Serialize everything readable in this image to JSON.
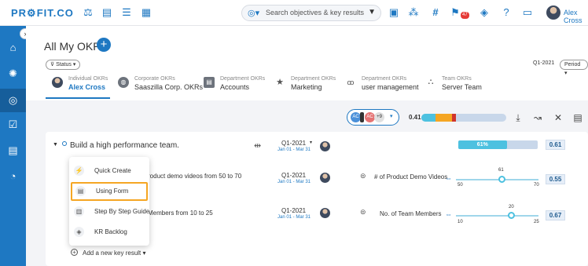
{
  "app": {
    "logo": "PR⚙FIT.CO"
  },
  "search": {
    "placeholder": "Search objectives & key results"
  },
  "topbar": {
    "notification_count": "47",
    "user_name": "Alex Cross"
  },
  "page": {
    "title": "All My OKRs",
    "status_filter": "Status",
    "quarter": "Q1-2021",
    "period": "Period"
  },
  "tabs": [
    {
      "label": "Individual OKRs",
      "value": "Alex Cross"
    },
    {
      "label": "Corporate OKRs",
      "value": "Saaszilla Corp. OKRs"
    },
    {
      "label": "Department OKRs",
      "value": "Accounts"
    },
    {
      "label": "Department OKRs",
      "value": "Marketing"
    },
    {
      "label": "Department OKRs",
      "value": "user management"
    },
    {
      "label": "Team OKRs",
      "value": "Server Team"
    }
  ],
  "summary": {
    "avatars": [
      "AC",
      "AC"
    ],
    "extra_count": "+9",
    "score": "0.41",
    "segments": [
      {
        "color": "#4dc1e0",
        "fraction": 0.17
      },
      {
        "color": "#f5a623",
        "fraction": 0.19
      },
      {
        "color": "#d0342c",
        "fraction": 0.05
      }
    ]
  },
  "objective": {
    "title": "Build a high performance team.",
    "date": "Q1-2021",
    "date_range": "Jan 01 - Mar 31",
    "progress_label": "61%",
    "progress": 0.61,
    "score": "0.61"
  },
  "key_results": [
    {
      "text": "roduct demo videos from 50 to 70",
      "date": "Q1-2021",
      "date_range": "Jan 01 - Mar 31",
      "metric": "# of Product Demo Videos",
      "current": "61",
      "start": "50",
      "target": "70",
      "progress": 0.55,
      "score": "0.55"
    },
    {
      "text": "Members from 10 to 25",
      "date": "Q1-2021",
      "date_range": "Jan 01 - Mar 31",
      "metric": "No. of Team Members",
      "current": "20",
      "start": "10",
      "target": "25",
      "progress": 0.67,
      "score": "0.67"
    }
  ],
  "menu": {
    "items": [
      {
        "label": "Quick Create",
        "icon": "lightning-icon"
      },
      {
        "label": "Using Form",
        "icon": "form-icon"
      },
      {
        "label": "Step By Step Guide",
        "icon": "guide-icon"
      },
      {
        "label": "KR Backlog",
        "icon": "backlog-icon"
      }
    ],
    "add_label": "Add a new key result"
  },
  "colors": {
    "brand": "#1e78c2",
    "highlight": "#f5a623"
  }
}
